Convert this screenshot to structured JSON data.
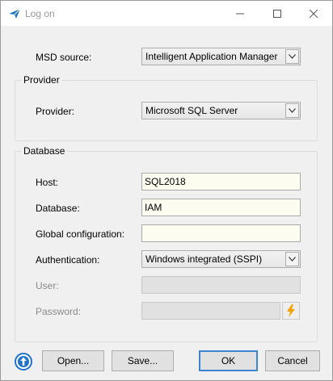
{
  "window": {
    "title": "Log on"
  },
  "msd": {
    "label": "MSD source:",
    "value": "Intelligent Application Manager"
  },
  "provider_group": {
    "title": "Provider",
    "provider_label": "Provider:",
    "provider_value": "Microsoft SQL Server"
  },
  "database_group": {
    "title": "Database",
    "host_label": "Host:",
    "host_value": "SQL2018",
    "database_label": "Database:",
    "database_value": "IAM",
    "global_config_label": "Global configuration:",
    "global_config_value": "",
    "auth_label": "Authentication:",
    "auth_value": "Windows integrated (SSPI)",
    "user_label": "User:",
    "user_value": "",
    "password_label": "Password:",
    "password_value": ""
  },
  "buttons": {
    "open": "Open...",
    "save": "Save...",
    "ok": "OK",
    "cancel": "Cancel"
  },
  "icons": {
    "app": "paper-plane-icon",
    "upload": "arrow-up-circle-icon",
    "generate": "lightning-icon"
  },
  "colors": {
    "accent": "#1e73c8",
    "lightning": "#f5a100",
    "default_button_border": "#3c84d4"
  }
}
